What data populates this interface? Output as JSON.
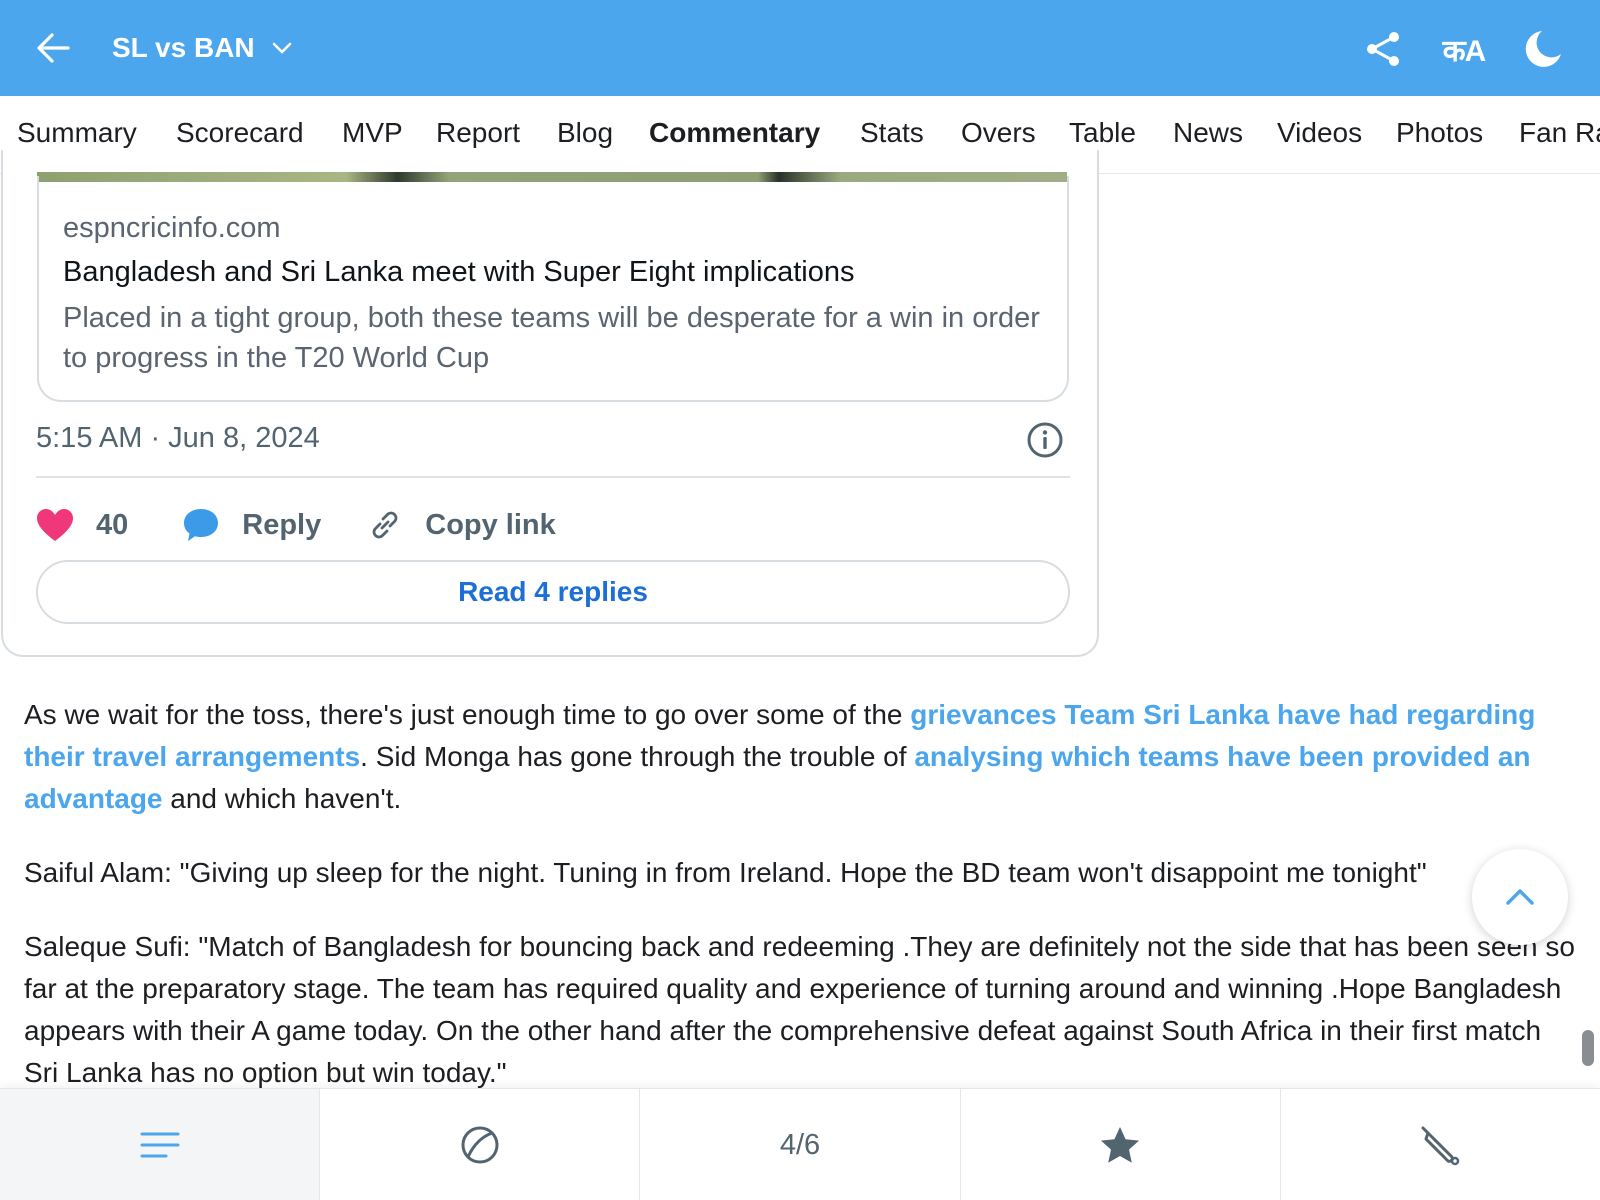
{
  "header": {
    "title": "SL vs BAN",
    "language_icon_label": "कA"
  },
  "tabs": [
    {
      "label": "Summary"
    },
    {
      "label": "Scorecard"
    },
    {
      "label": "MVP"
    },
    {
      "label": "Report"
    },
    {
      "label": "Blog"
    },
    {
      "label": "Commentary",
      "active": true
    },
    {
      "label": "Stats"
    },
    {
      "label": "Overs"
    },
    {
      "label": "Table"
    },
    {
      "label": "News"
    },
    {
      "label": "Videos"
    },
    {
      "label": "Photos"
    },
    {
      "label": "Fan Ra"
    }
  ],
  "tweet": {
    "link_domain": "espncricinfo.com",
    "link_title": "Bangladesh and Sri Lanka meet with Super Eight implications",
    "link_description": "Placed in a tight group, both these teams will be desperate for a win in order to progress in the T20 World Cup",
    "timestamp": "5:15 AM · Jun 8, 2024",
    "likes": "40",
    "reply_label": "Reply",
    "copy_link_label": "Copy link",
    "read_replies_label": "Read 4 replies"
  },
  "commentary": {
    "p1": {
      "t1": "As we wait for the toss, there's just enough time to go over some of the ",
      "link1": "grievances Team Sri Lanka have had regarding their travel arrangements",
      "t2": ". Sid Monga has gone through the trouble of ",
      "link2": "analysing which teams have been provided an advantage",
      "t3": " and which haven't."
    },
    "p2": "Saiful Alam: \"Giving up sleep for the night. Tuning in from Ireland. Hope the BD team won't disappoint me tonight\"",
    "p3": "Saleque Sufi: \"Match of Bangladesh for bouncing back and redeeming .They are definitely not the side that has been seen so far at the preparatory stage. The team has required quality and experience of turning around and winning .Hope Bangladesh appears with their A game today. On the other hand after the comprehensive defeat against South Africa in their first match Sri Lanka has no option but win today.\""
  },
  "bottom_nav": {
    "page_indicator": "4/6"
  },
  "colors": {
    "header_bg": "#4ba6ee",
    "link": "#4ba6ee",
    "like": "#f0377a",
    "reply": "#3b9be8",
    "read_replies": "#1d6fd6"
  }
}
